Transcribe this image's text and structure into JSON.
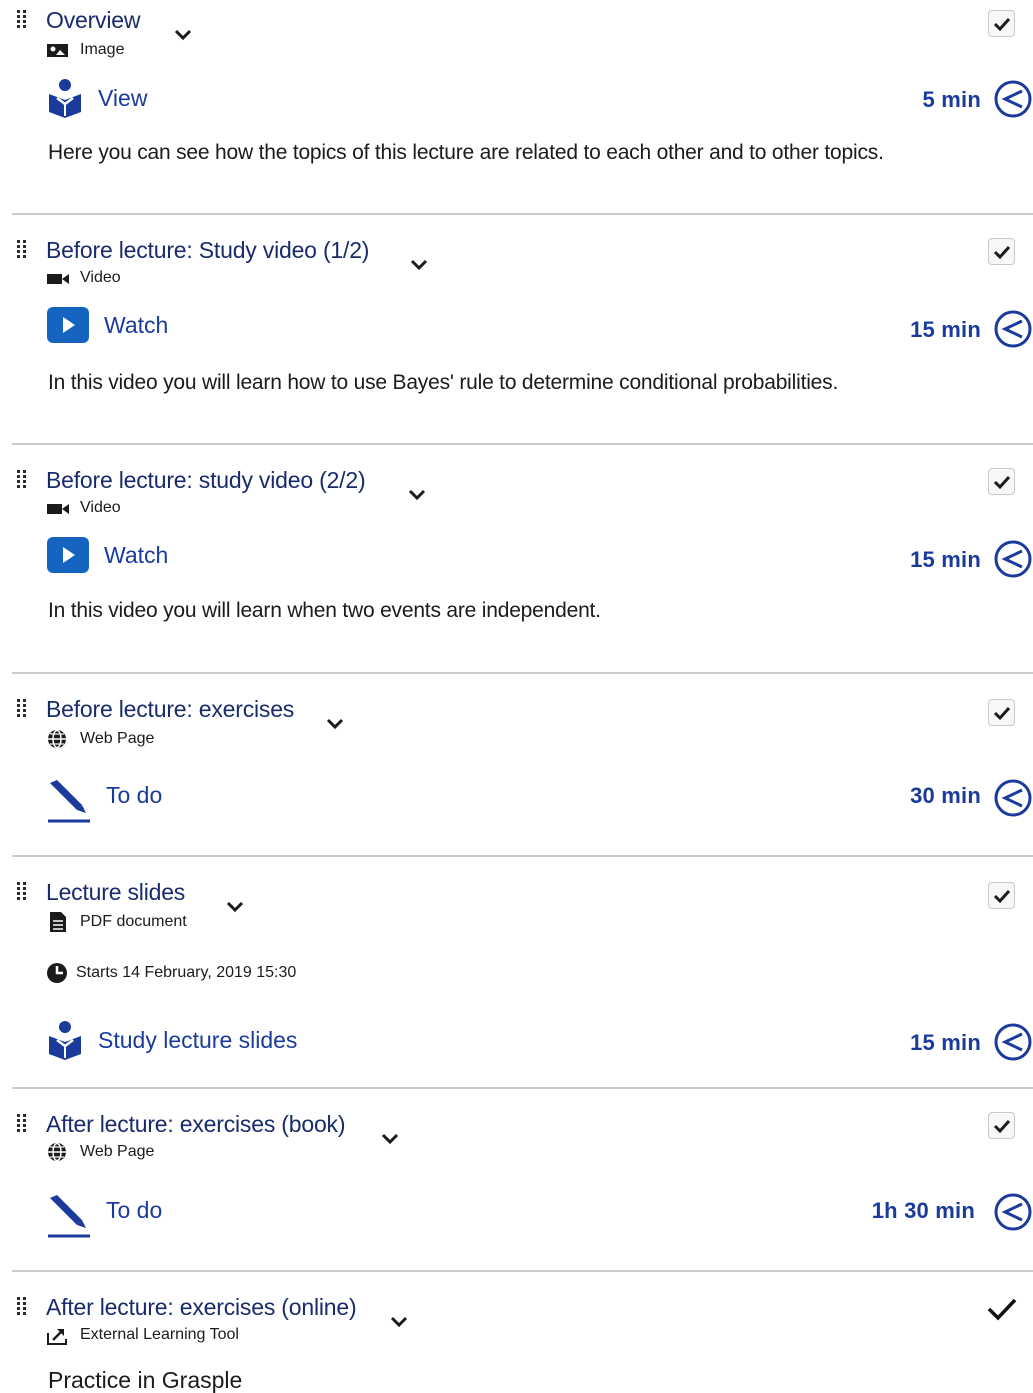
{
  "items": [
    {
      "title": "Overview",
      "type_label": "Image",
      "type_icon": "image-icon",
      "action_label": "View",
      "action_icon": "reader-icon",
      "duration": "5 min",
      "description": "Here you can see how the topics of this lecture are related to each other and to other topics.",
      "completed": true
    },
    {
      "title": "Before lecture: Study video (1/2)",
      "type_label": "Video",
      "type_icon": "video-camera-icon",
      "action_label": "Watch",
      "action_icon": "play-icon",
      "duration": "15 min",
      "description": "In this video you will learn how to use Bayes' rule to determine conditional probabilities.",
      "completed": true
    },
    {
      "title": "Before lecture: study video (2/2)",
      "type_label": "Video",
      "type_icon": "video-camera-icon",
      "action_label": "Watch",
      "action_icon": "play-icon",
      "duration": "15 min",
      "description": "In this video you will learn when two events are independent.",
      "completed": true
    },
    {
      "title": "Before lecture: exercises",
      "type_label": "Web Page",
      "type_icon": "globe-icon",
      "action_label": "To do",
      "action_icon": "pen-icon",
      "duration": "30 min",
      "completed": true
    },
    {
      "title": "Lecture slides",
      "type_label": "PDF document",
      "type_icon": "document-icon",
      "starts_label": "Starts 14 February, 2019 15:30",
      "action_label": "Study lecture slides",
      "action_icon": "reader-icon",
      "duration": "15 min",
      "completed": true
    },
    {
      "title": "After lecture: exercises (book)",
      "type_label": "Web Page",
      "type_icon": "globe-icon",
      "action_label": "To do",
      "action_icon": "pen-icon",
      "duration": "1h 30 min",
      "completed": true
    },
    {
      "title": "After lecture: exercises (online)",
      "type_label": "External Learning Tool",
      "type_icon": "external-tool-icon",
      "footer_text": "Practice in Grasple",
      "completed": true
    }
  ],
  "colors": {
    "title": "#1a2b6b",
    "action": "#1a3b9c",
    "play_button": "#1565c0",
    "separator": "#c8ccd0"
  }
}
